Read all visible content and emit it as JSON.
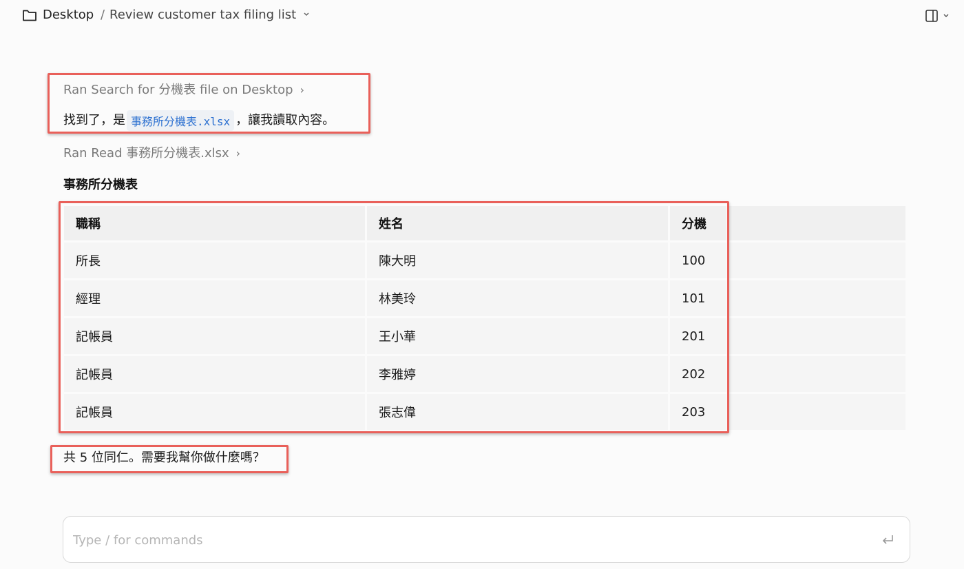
{
  "header": {
    "root": "Desktop",
    "separator": "/",
    "title": "Review customer tax filing list"
  },
  "steps": {
    "search": "Ran Search for 分機表 file on Desktop",
    "read": "Ran Read 事務所分機表.xlsx",
    "chevron": "›"
  },
  "message": {
    "prefix": "找到了，是",
    "file": "事務所分機表.xlsx",
    "suffix": "，讓我讀取內容。"
  },
  "table": {
    "title": "事務所分機表",
    "headers": [
      "職稱",
      "姓名",
      "分機"
    ],
    "rows": [
      [
        "所長",
        "陳大明",
        "100"
      ],
      [
        "經理",
        "林美玲",
        "101"
      ],
      [
        "記帳員",
        "王小華",
        "201"
      ],
      [
        "記帳員",
        "李雅婷",
        "202"
      ],
      [
        "記帳員",
        "張志偉",
        "203"
      ]
    ]
  },
  "summary": "共 5 位同仁。需要我幫你做什麼嗎？",
  "composer": {
    "placeholder": "Type / for commands"
  },
  "colors": {
    "highlight": "#e9605a",
    "code_text": "#2a6fd0",
    "background": "#fbfbfb"
  }
}
